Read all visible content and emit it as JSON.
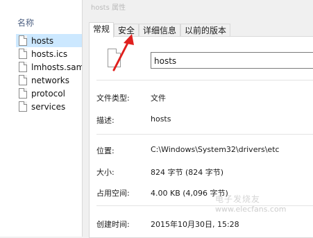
{
  "explorer": {
    "column_header": "名称",
    "files": [
      "hosts",
      "hosts.ics",
      "lmhosts.sam",
      "networks",
      "protocol",
      "services"
    ]
  },
  "dialog": {
    "title": "hosts 属性",
    "tabs": [
      "常规",
      "安全",
      "详细信息",
      "以前的版本"
    ],
    "file_name": "hosts",
    "properties": {
      "type_label": "文件类型:",
      "type_value": "文件",
      "desc_label": "描述:",
      "desc_value": "hosts",
      "location_label": "位置:",
      "location_value": "C:\\Windows\\System32\\drivers\\etc",
      "size_label": "大小:",
      "size_value": "824 字节 (824 字节)",
      "disk_label": "占用空间:",
      "disk_value": "4.00 KB (4,096 字节)",
      "created_label": "创建时间:",
      "created_value": "2015年10月30日, 15:28"
    }
  },
  "annotation": {
    "arrow_color": "#e0201e"
  },
  "watermark": {
    "site": "www.elecfans.com",
    "brand": "电子发烧友"
  }
}
